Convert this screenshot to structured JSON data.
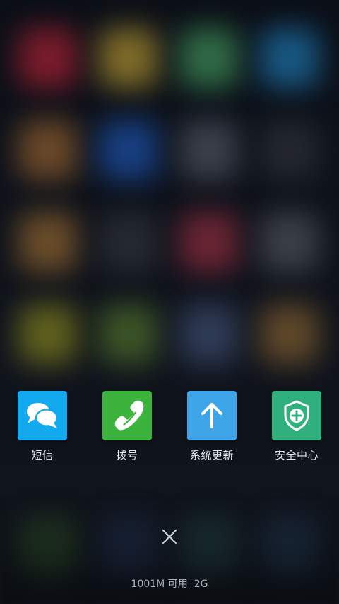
{
  "recent_apps": [
    {
      "label": "短信",
      "tile_color": "#12a9ee",
      "icon": "message-bubbles-icon"
    },
    {
      "label": "拨号",
      "tile_color": "#3cb33c",
      "icon": "phone-handset-icon"
    },
    {
      "label": "系统更新",
      "tile_color": "#3ea6e8",
      "icon": "arrow-up-icon"
    },
    {
      "label": "安全中心",
      "tile_color": "#2fb07d",
      "icon": "shield-plus-icon"
    }
  ],
  "close_button": {
    "icon": "close-icon"
  },
  "memory_status": {
    "memory_text": "1001M 可用",
    "network_text": "2G"
  },
  "colors": {
    "background": "#0b0f17",
    "label_text": "#e6e9ee",
    "status_text": "#aab1bb"
  }
}
